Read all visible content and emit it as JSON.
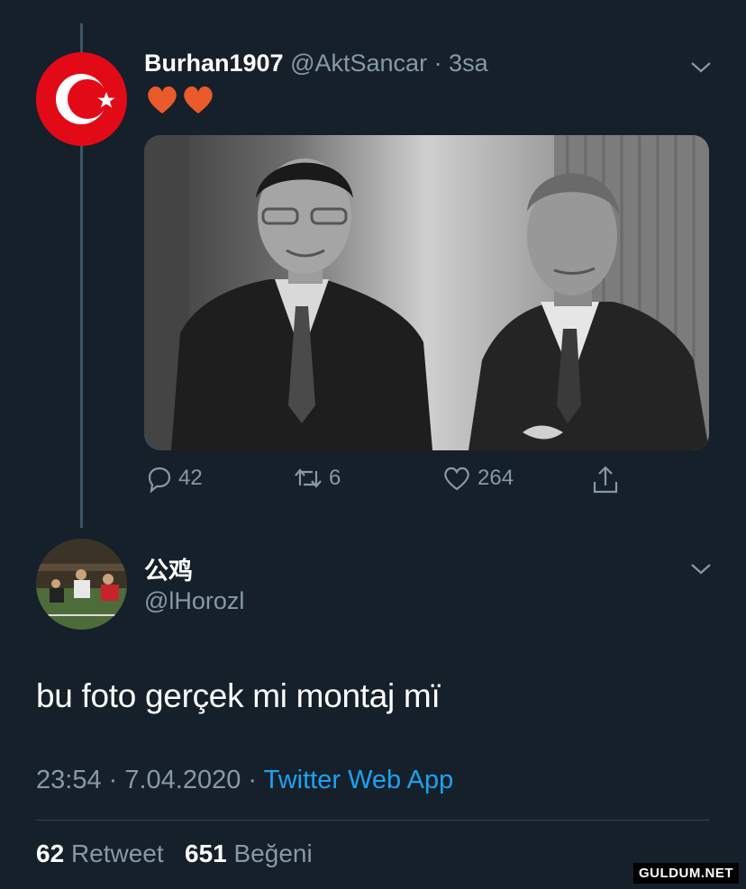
{
  "tweet": {
    "display_name": "Burhan1907",
    "handle_time": "@AktSancar · 3sa",
    "avatar_icon": "turkish-flag-icon",
    "emoji_text": "heart-emoji heart-emoji",
    "replies": "42",
    "retweets": "6",
    "likes": "264"
  },
  "reply": {
    "display_name": "公鸡",
    "handle": "@lHorozl",
    "text": "bu foto gerçek mi montaj mï",
    "time_date": "23:54 · 7.04.2020 · ",
    "source": "Twitter Web App",
    "retweet_count": "62",
    "retweet_label": "Retweet",
    "like_count": "651",
    "like_label": "Beğeni"
  },
  "watermark": "GULDUM.NET",
  "colors": {
    "background": "#15202b",
    "secondary_text": "#8899a6",
    "link": "#1da1f2",
    "flag_red": "#e30a17"
  }
}
